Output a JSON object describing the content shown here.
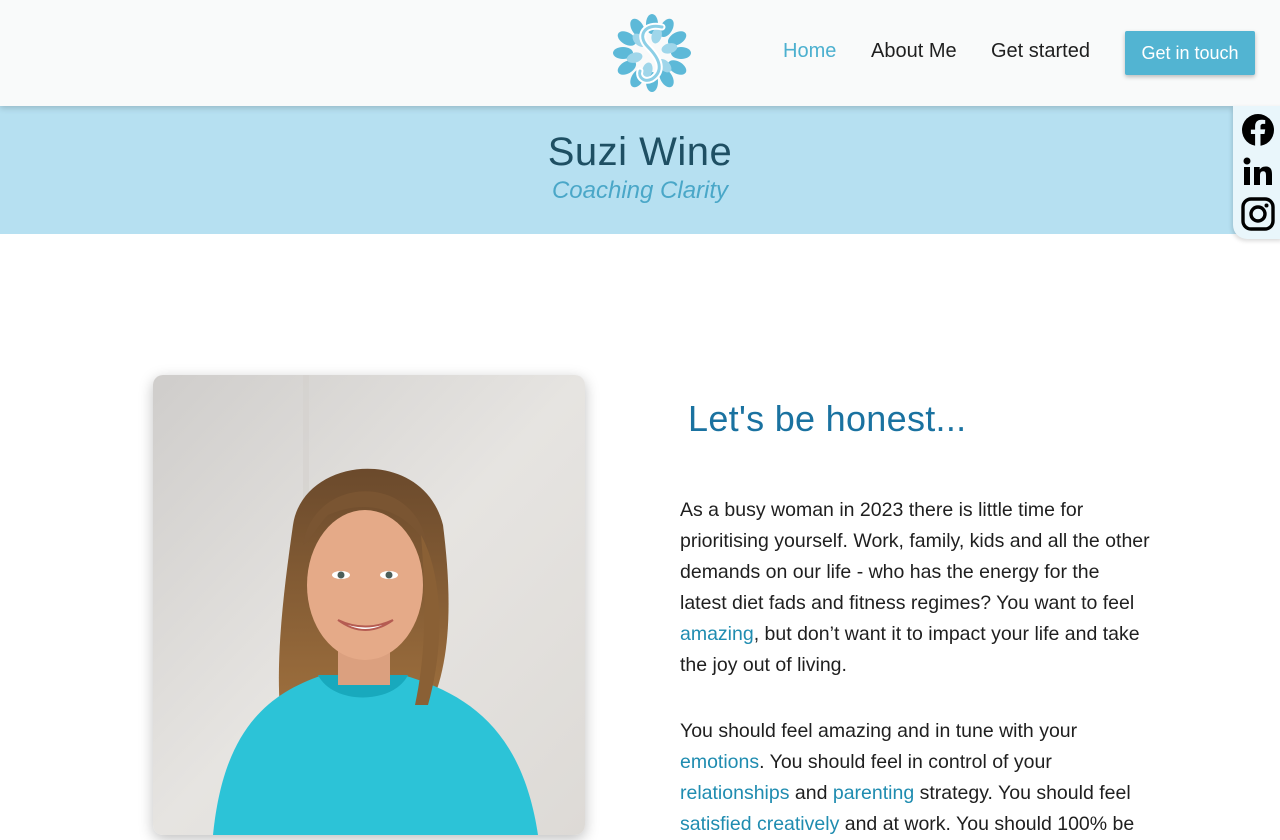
{
  "nav": {
    "items": [
      {
        "label": "Home",
        "active": true
      },
      {
        "label": "About Me",
        "active": false
      },
      {
        "label": "Get started",
        "active": false
      }
    ],
    "cta_label": "Get in touch"
  },
  "hero": {
    "title": "Suzi Wine",
    "subtitle": "Coaching Clarity"
  },
  "social": [
    "facebook-icon",
    "linkedin-icon",
    "instagram-icon"
  ],
  "content": {
    "heading": "Let's be honest...",
    "p1": {
      "t1": "As a busy woman in 2023 there is little time for prioritising yourself. Work, family, kids and all the other demands on our life - who has the energy for the latest diet fads and fitness regimes? You want to feel ",
      "link1": "amazing",
      "t2": ", but don’t want it to impact your life and take the joy out of living."
    },
    "p2": {
      "t1": "You should feel amazing and in tune with your ",
      "link1": "emotions",
      "t2": ". You should feel in control of your ",
      "link2": "relationships",
      "t3": " and ",
      "link3": "parenting",
      "t4": " strategy. You should feel ",
      "link4": "satisfied creatively",
      "t5": " and at work. You should 100% be"
    }
  },
  "colors": {
    "accent": "#52b4d2",
    "hero_bg": "#b6e0f1",
    "heading": "#1a72a0",
    "link": "#1f8cb0"
  }
}
